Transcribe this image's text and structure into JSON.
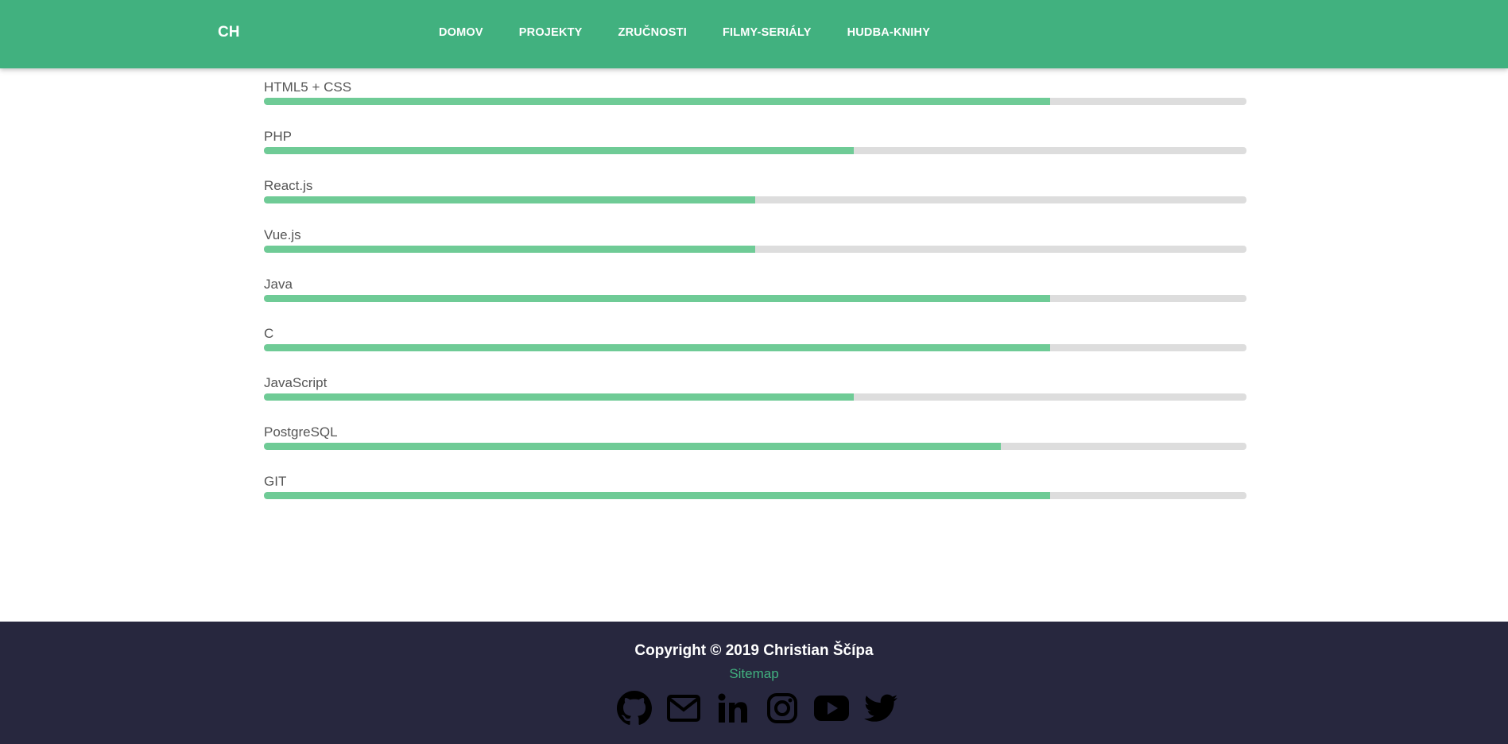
{
  "nav": {
    "brand": "CH",
    "links": [
      {
        "label": "DOMOV"
      },
      {
        "label": "PROJEKTY"
      },
      {
        "label": "ZRUČNOSTI"
      },
      {
        "label": "FILMY-SERIÁLY"
      },
      {
        "label": "HUDBA-KNIHY"
      }
    ]
  },
  "skills": [
    {
      "name": "HTML5 + CSS",
      "level": 0.8
    },
    {
      "name": "PHP",
      "level": 0.6
    },
    {
      "name": "React.js",
      "level": 0.5
    },
    {
      "name": "Vue.js",
      "level": 0.5
    },
    {
      "name": "Java",
      "level": 0.8
    },
    {
      "name": "C",
      "level": 0.8
    },
    {
      "name": "JavaScript",
      "level": 0.6
    },
    {
      "name": "PostgreSQL",
      "level": 0.75
    },
    {
      "name": "GIT",
      "level": 0.8
    }
  ],
  "footer": {
    "copyright": "Copyright © 2019 Christian Ščípa",
    "sitemap": "Sitemap",
    "socials": [
      "github-icon",
      "mail-icon",
      "linkedin-icon",
      "instagram-icon",
      "youtube-icon",
      "twitter-icon"
    ]
  },
  "colors": {
    "primary": "#41b17f",
    "bar_fill": "#6fcb96",
    "bar_track": "#dddddd",
    "footer_bg": "#27273e"
  }
}
